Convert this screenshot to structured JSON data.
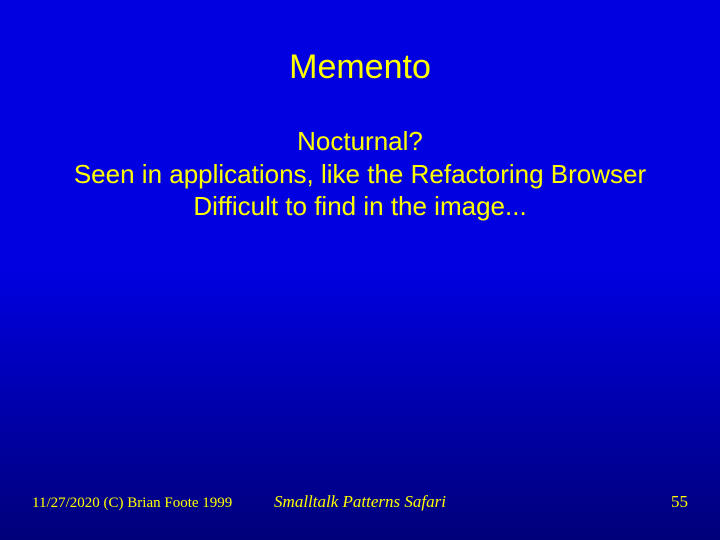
{
  "slide": {
    "title": "Memento",
    "body": {
      "line1": "Nocturnal?",
      "line2": "Seen in applications, like the Refactoring Browser",
      "line3": "Difficult to find in the image..."
    },
    "footer": {
      "left": "11/27/2020 (C) Brian Foote 1999",
      "center": "Smalltalk Patterns Safari",
      "right": "55"
    }
  }
}
